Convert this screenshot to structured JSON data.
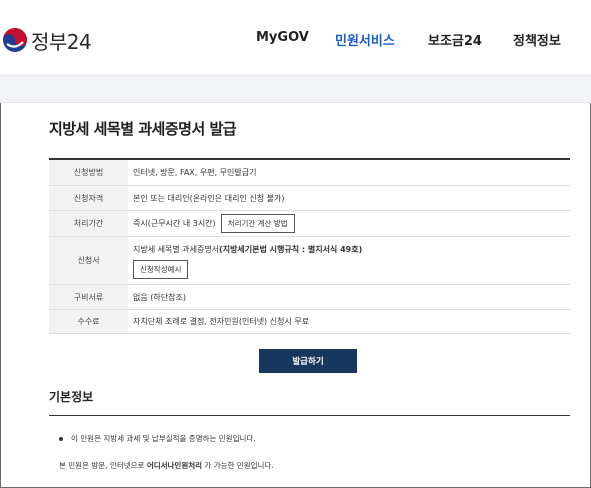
{
  "header": {
    "logo_text": "정부24",
    "nav": [
      {
        "label": "MyGOV",
        "active": false
      },
      {
        "label": "민원서비스",
        "active": true
      },
      {
        "label": "보조금24",
        "active": false
      },
      {
        "label": "정책정보",
        "active": false
      }
    ]
  },
  "page": {
    "title": "지방세 세목별 과세증명서 발급"
  },
  "info_table": [
    {
      "label": "신청방법",
      "value": "인터넷, 방문, FAX, 우편, 무인발급기"
    },
    {
      "label": "신청자격",
      "value": "본인 또는 대리인(온라인은 대리인 신청 불가)"
    },
    {
      "label": "처리기간",
      "value": "즉시(근무시간 내 3시간)",
      "button": "처리기간 계산 방법"
    },
    {
      "label": "신청서",
      "value_prefix": "지방세 세목별 과세증명서 ",
      "value_bold": "(지방세기본법 시행규칙 : 별지서식 49호)",
      "button": "신청작성예시"
    },
    {
      "label": "구비서류",
      "value": "없음 (하단참조)"
    },
    {
      "label": "수수료",
      "value": "자치단체 조례로 결정, 전자민원(인터넷) 신청시 무료"
    }
  ],
  "actions": {
    "issue_label": "발급하기"
  },
  "basic_info": {
    "title": "기본정보",
    "bullet": "이 민원은 지방세 과세 및 납부실적을 증명하는 민원입니다.",
    "note_prefix": "본 민원은 방문, 인터넷으로 ",
    "note_bold": "어디서나민원처리",
    "note_suffix": " 가 가능한 민원입니다."
  },
  "colors": {
    "accent": "#1a5bc7",
    "primary_button": "#17375e",
    "table_label_bg": "#f2f2f2",
    "band_bg": "#f3f4f7",
    "logo_red": "#c8102e",
    "logo_blue": "#1c3f94"
  }
}
